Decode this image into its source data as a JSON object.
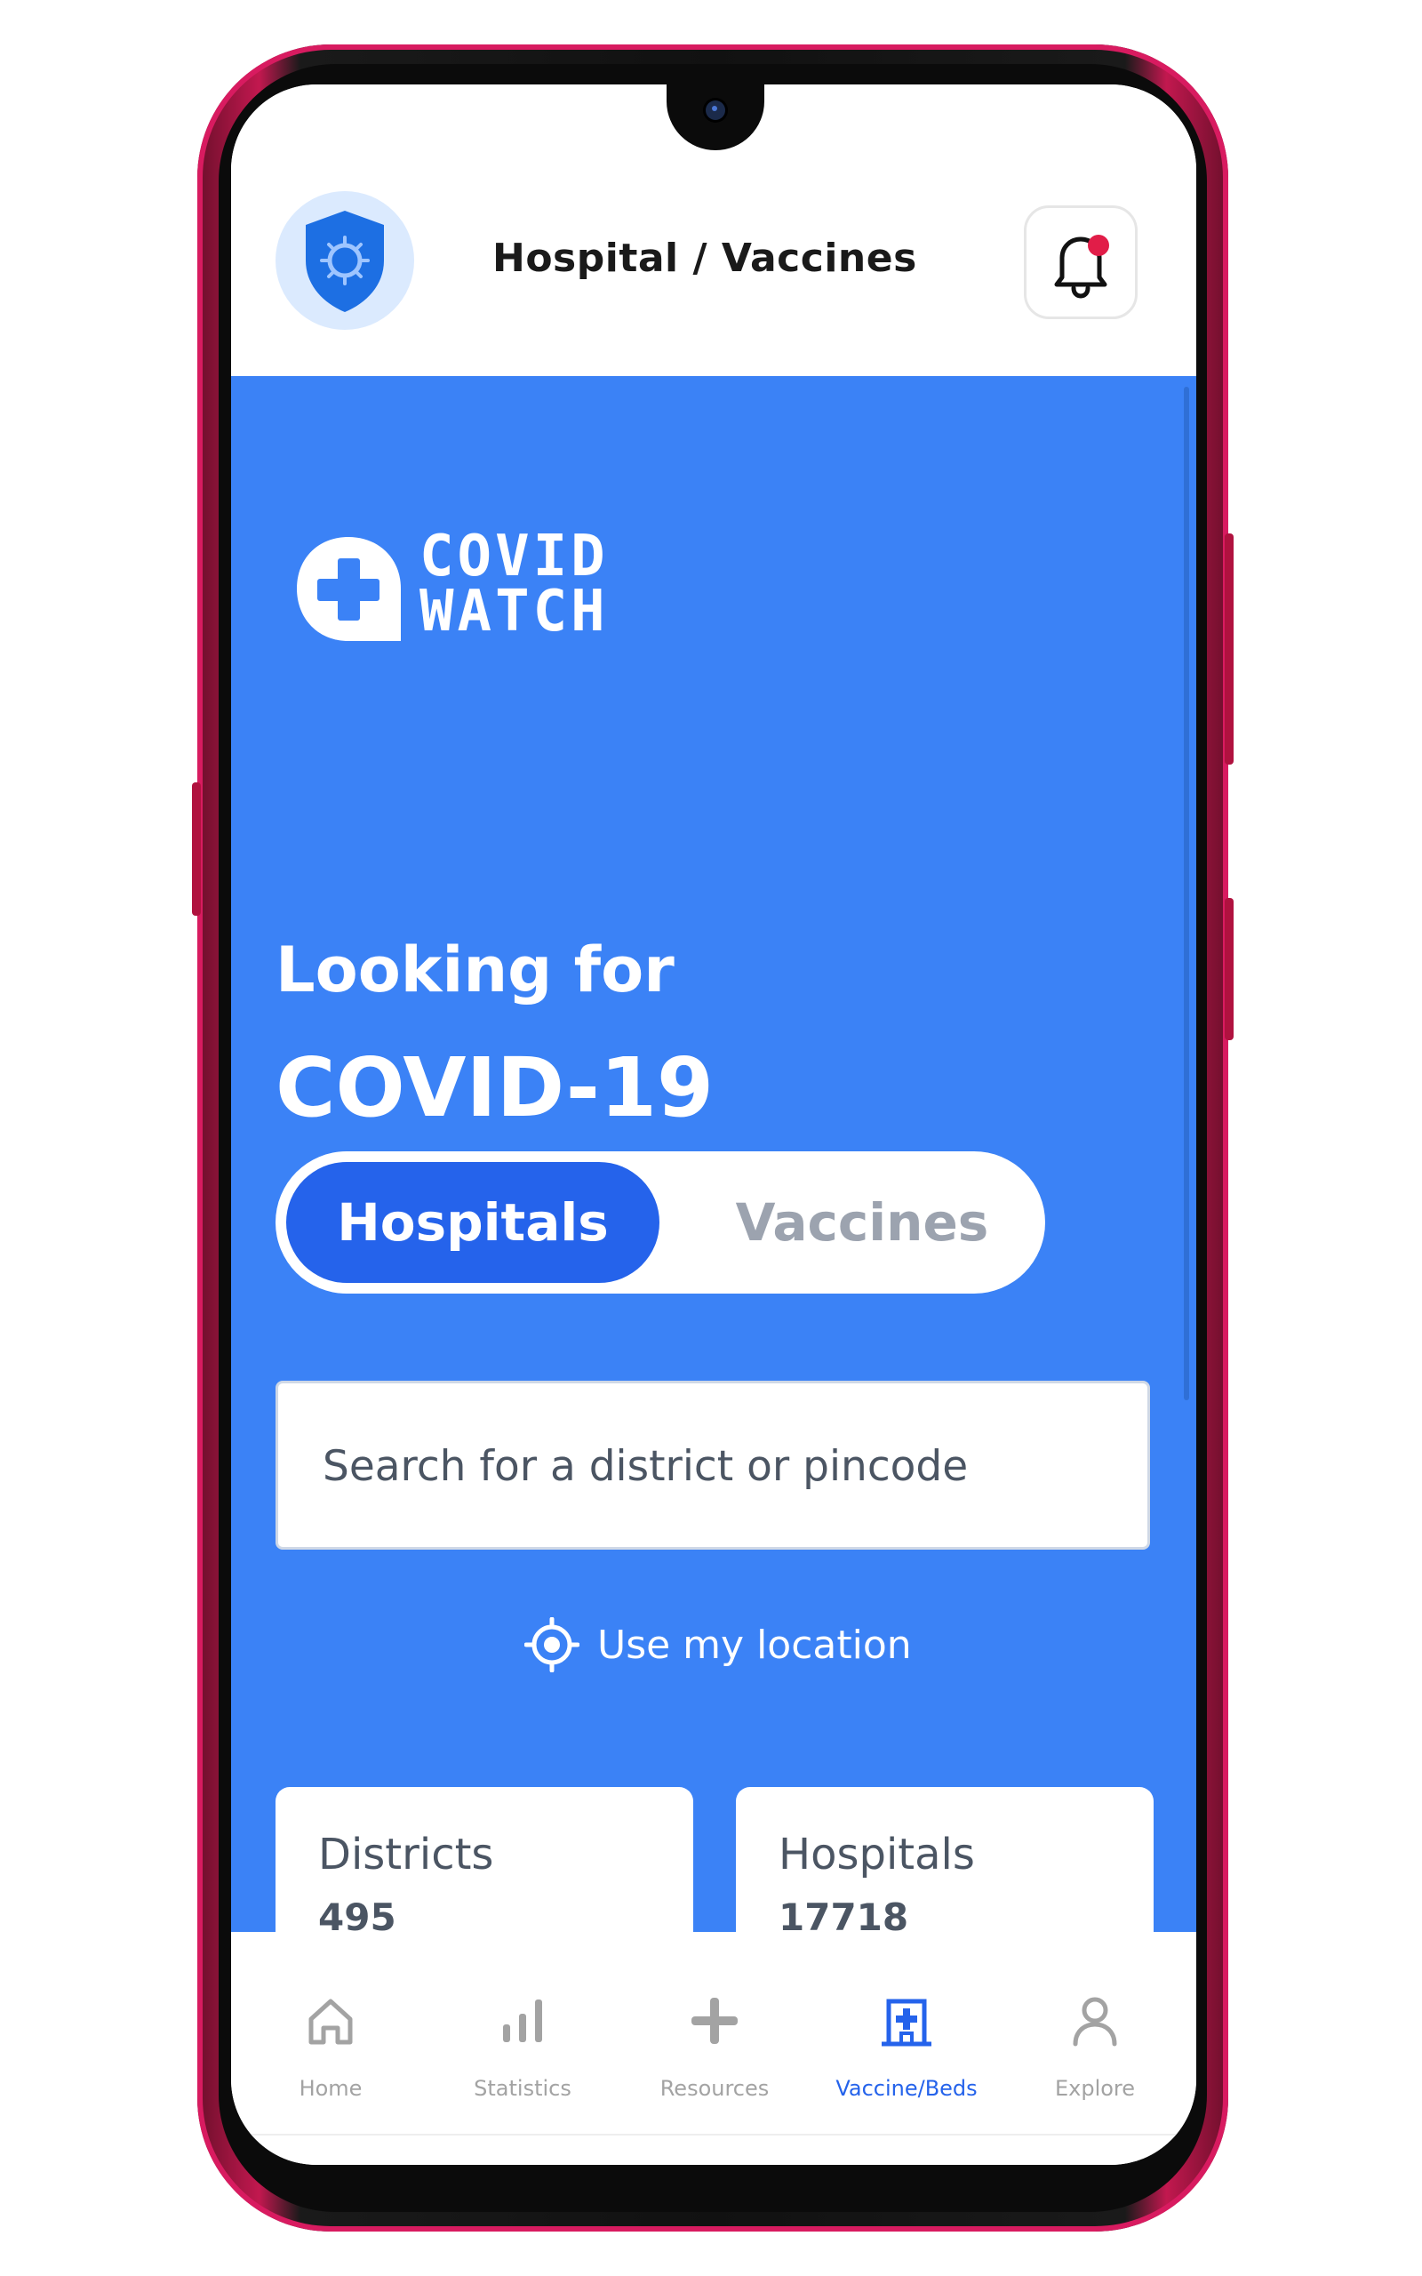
{
  "header": {
    "title": "Hospital / Vaccines"
  },
  "logo": {
    "line1": "COVID",
    "line2": "WATCH"
  },
  "hero": {
    "looking_for": "Looking for",
    "title": "COVID-19"
  },
  "toggle": {
    "options": [
      "Hospitals",
      "Vaccines"
    ],
    "selected": "Hospitals"
  },
  "search": {
    "placeholder": "Search for a district or pincode",
    "value": ""
  },
  "location": {
    "label": "Use my location"
  },
  "stats": [
    {
      "label": "Districts",
      "value": "495"
    },
    {
      "label": "Hospitals",
      "value": "17718"
    }
  ],
  "bottom_nav": {
    "items": [
      {
        "label": "Home",
        "icon": "home-icon",
        "active": false
      },
      {
        "label": "Statistics",
        "icon": "bar-chart-icon",
        "active": false
      },
      {
        "label": "Resources",
        "icon": "plus-icon",
        "active": false
      },
      {
        "label": "Vaccine/Beds",
        "icon": "hospital-icon",
        "active": true
      },
      {
        "label": "Explore",
        "icon": "user-icon",
        "active": false
      }
    ]
  },
  "colors": {
    "primary": "#3b82f6",
    "active": "#2563eb",
    "phone_frame": "#c2184f",
    "notification_dot": "#e11d48"
  }
}
